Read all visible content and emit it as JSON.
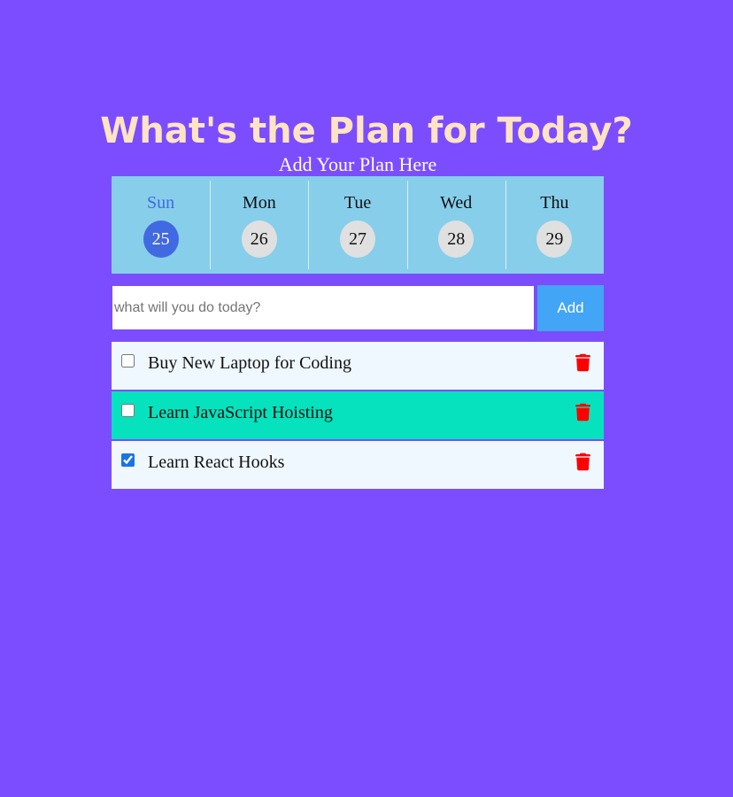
{
  "header": {
    "title": "What's the Plan for Today?",
    "subtitle": "Add Your Plan Here"
  },
  "calendar": {
    "selected_index": 0,
    "days": [
      {
        "name": "Sun",
        "date": "25"
      },
      {
        "name": "Mon",
        "date": "26"
      },
      {
        "name": "Tue",
        "date": "27"
      },
      {
        "name": "Wed",
        "date": "28"
      },
      {
        "name": "Thu",
        "date": "29"
      }
    ]
  },
  "form": {
    "input_value": "",
    "input_placeholder": "what will you do today?",
    "add_label": "Add"
  },
  "todos": [
    {
      "text": "Buy New Laptop for Coding",
      "checked": false,
      "highlighted": false,
      "delete_icon": "trash-icon"
    },
    {
      "text": "Learn JavaScript Hoisting",
      "checked": false,
      "highlighted": true,
      "delete_icon": "trash-icon"
    },
    {
      "text": "Learn React Hooks",
      "checked": true,
      "highlighted": false,
      "delete_icon": "trash-icon"
    }
  ],
  "colors": {
    "background": "#7c4dff",
    "title": "#ffe4c4",
    "calendar_bg": "#87ceeb",
    "selected_day": "#4169e1",
    "add_button": "#42a5f5",
    "todo_bg": "#f0f8ff",
    "todo_highlight": "#06e2bd",
    "delete_icon": "#ff0000"
  }
}
